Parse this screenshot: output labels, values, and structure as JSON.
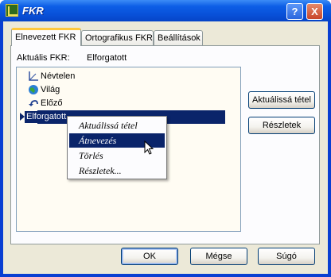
{
  "window": {
    "title": "FKR",
    "help_label": "?",
    "close_label": "X"
  },
  "tabs": [
    {
      "label": "Elnevezett FKR"
    },
    {
      "label": "Ortografikus FKR"
    },
    {
      "label": "Beállítások"
    }
  ],
  "current": {
    "label": "Aktuális FKR:",
    "value": "Elforgatott"
  },
  "tree": [
    {
      "label": "Névtelen",
      "icon": "axes-icon"
    },
    {
      "label": "Világ",
      "icon": "globe-icon"
    },
    {
      "label": "Előző",
      "icon": "undo-arrow-icon"
    },
    {
      "label": "Elforgatott",
      "icon": "current-pointer-icon",
      "selected": true
    }
  ],
  "side_buttons": {
    "set_current": "Aktuálissá tétel",
    "details": "Részletek"
  },
  "context_menu": [
    {
      "label": "Aktuálissá tétel"
    },
    {
      "label": "Átnevezés",
      "highlighted": true
    },
    {
      "label": "Törlés"
    },
    {
      "label": "Részletek..."
    }
  ],
  "footer": {
    "ok": "OK",
    "cancel": "Mégse",
    "help": "Súgó"
  },
  "colors": {
    "selection": "#0a246a",
    "titlebar": "#0850d8",
    "face": "#ece9d8"
  }
}
